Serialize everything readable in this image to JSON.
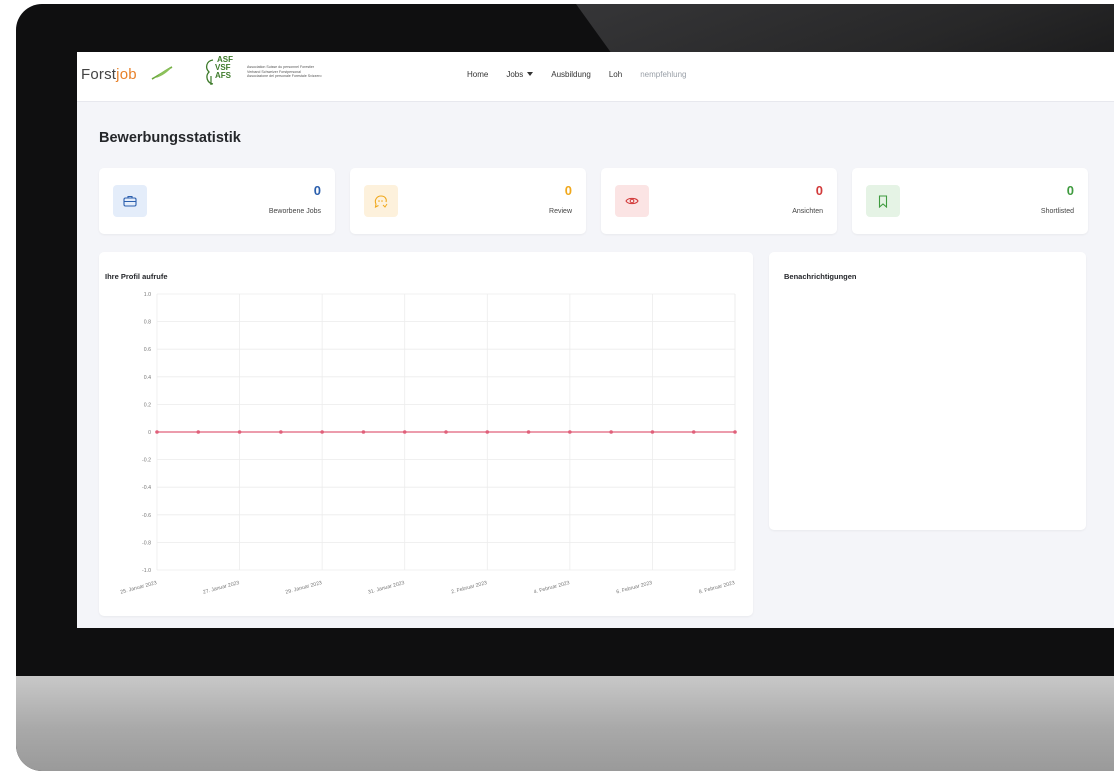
{
  "brand": {
    "name_part1": "Forst",
    "name_part2": "job"
  },
  "partner_logo": {
    "mark_lines": [
      "ASF",
      "VSF",
      "AFS"
    ],
    "text_lines": [
      "Association Suisse du personnel Forestier",
      "Verband Schweizer Forstpersonal",
      "Associazione del personale Forestale Svizzero"
    ]
  },
  "nav": {
    "home": "Home",
    "jobs": "Jobs",
    "ausbildung": "Ausbildung",
    "lohn_a": "Loh",
    "lohn_b": "nempfehlung"
  },
  "page_title": "Bewerbungsstatistik",
  "stats": [
    {
      "value": "0",
      "label": "Beworbene Jobs",
      "color": "#2b5fad",
      "bg": "#e4edfa",
      "icon": "briefcase-icon"
    },
    {
      "value": "0",
      "label": "Review",
      "color": "#f0a81c",
      "bg": "#fdf1dc",
      "icon": "review-bubble-icon"
    },
    {
      "value": "0",
      "label": "Ansichten",
      "color": "#d23b3b",
      "bg": "#fbe4e4",
      "icon": "eye-icon"
    },
    {
      "value": "0",
      "label": "Shortlisted",
      "color": "#3f9b3f",
      "bg": "#e5f3e5",
      "icon": "bookmark-icon"
    }
  ],
  "chart_panel": {
    "title": "Ihre Profil aufrufe"
  },
  "notifications_panel": {
    "title": "Benachrichtigungen"
  },
  "chart_data": {
    "type": "line",
    "title": "Ihre Profil aufrufe",
    "xlabel": "",
    "ylabel": "",
    "ylim": [
      -1.0,
      1.0
    ],
    "yticks": [
      "1.0",
      "0.8",
      "0.6",
      "0.4",
      "0.2",
      "0",
      "-0.2",
      "-0.4",
      "-0.6",
      "-0.8",
      "-1.0"
    ],
    "xtick_labels": [
      "25. Januar 2023",
      "27. Januar 2023",
      "29. Januar 2023",
      "31. Januar 2023",
      "2. Februar 2023",
      "4. Februar 2023",
      "6. Februar 2023",
      "8. Februar 2023"
    ],
    "x": [
      "25. Januar 2023",
      "26. Januar 2023",
      "27. Januar 2023",
      "28. Januar 2023",
      "29. Januar 2023",
      "30. Januar 2023",
      "31. Januar 2023",
      "1. Februar 2023",
      "2. Februar 2023",
      "3. Februar 2023",
      "4. Februar 2023",
      "5. Februar 2023",
      "6. Februar 2023",
      "7. Februar 2023",
      "8. Februar 2023"
    ],
    "series": [
      {
        "values": [
          0,
          0,
          0,
          0,
          0,
          0,
          0,
          0,
          0,
          0,
          0,
          0,
          0,
          0,
          0
        ],
        "color": "#e0607a"
      }
    ],
    "grid": true
  }
}
